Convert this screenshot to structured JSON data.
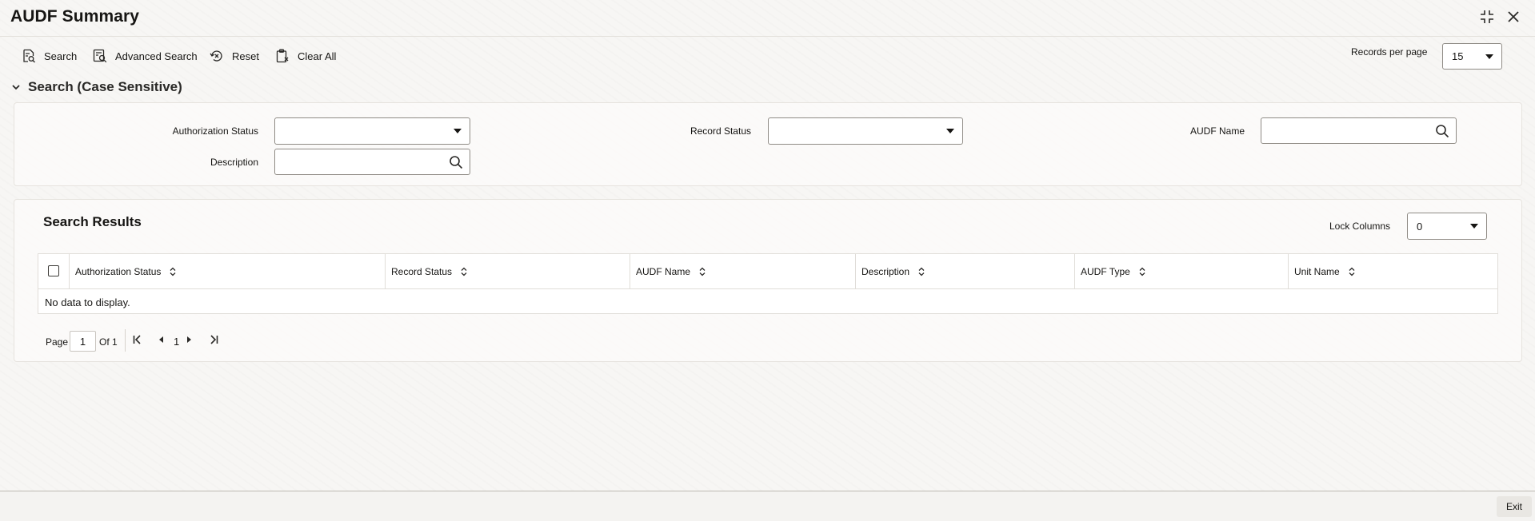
{
  "window": {
    "title": "AUDF Summary"
  },
  "toolbar": {
    "search": "Search",
    "advanced_search": "Advanced Search",
    "reset": "Reset",
    "clear_all": "Clear All",
    "records_per_page_label": "Records per page",
    "records_per_page_value": "15"
  },
  "search_section": {
    "header": "Search (Case Sensitive)",
    "fields": {
      "authorization_status_label": "Authorization Status",
      "record_status_label": "Record Status",
      "audf_name_label": "AUDF Name",
      "description_label": "Description"
    }
  },
  "results": {
    "title": "Search Results",
    "lock_columns_label": "Lock Columns",
    "lock_columns_value": "0",
    "columns": [
      "Authorization Status",
      "Record Status",
      "AUDF Name",
      "Description",
      "AUDF Type",
      "Unit Name"
    ],
    "empty_message": "No data to display."
  },
  "pager": {
    "page_label": "Page",
    "current_page": "1",
    "of_label": "Of 1",
    "page_number": "1"
  },
  "footer": {
    "exit": "Exit"
  },
  "icons": {
    "search": "search-doc-icon",
    "advanced_search": "advanced-search-icon",
    "reset": "reset-icon",
    "clear_all": "clipboard-icon",
    "collapse": "chevron-down-icon",
    "lookup": "magnifier-icon",
    "minimize": "compress-icon",
    "close": "close-icon"
  }
}
